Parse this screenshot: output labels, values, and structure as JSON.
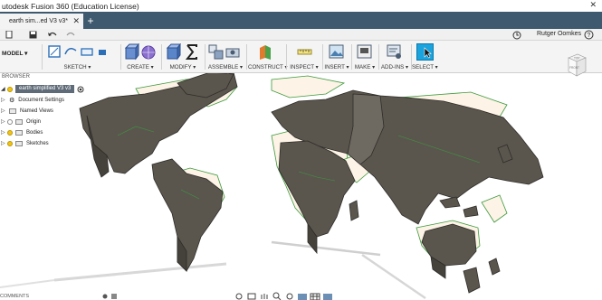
{
  "window": {
    "title": "utodesk Fusion 360 (Education License)",
    "close_glyph": "✕"
  },
  "tabs": {
    "doc_tab": "earth sim...ed V3 v3*",
    "close_glyph": "✕",
    "new_tab": "+"
  },
  "qat": {
    "user_name": "Rutger Oomkes",
    "help": "?"
  },
  "toolbar": {
    "model_label": "MODEL ▾",
    "groups": {
      "sketch": "SKETCH ▾",
      "create": "CREATE ▾",
      "modify": "MODIFY ▾",
      "assemble": "ASSEMBLE ▾",
      "construct": "CONSTRUCT ▾",
      "inspect": "INSPECT ▾",
      "insert": "INSERT ▾",
      "make": "MAKE ▾",
      "addins": "ADD-INS ▾",
      "select": "SELECT ▾"
    }
  },
  "browser": {
    "header": "BROWSER",
    "root": "earth simplified V3 v3",
    "items": [
      "Document Settings",
      "Named Views",
      "Origin",
      "Bodies",
      "Sketches"
    ]
  },
  "viewcube": {
    "top": "TOP",
    "front": "FRONT"
  },
  "bottom": {
    "comments": "COMMENTS"
  },
  "colors": {
    "tab_bar": "#3f5a6e",
    "select_blue": "#1aa3dd",
    "land_fill": "#fdf3e6",
    "land_outline": "#3b9a3b",
    "extrusion": "#58544c"
  }
}
